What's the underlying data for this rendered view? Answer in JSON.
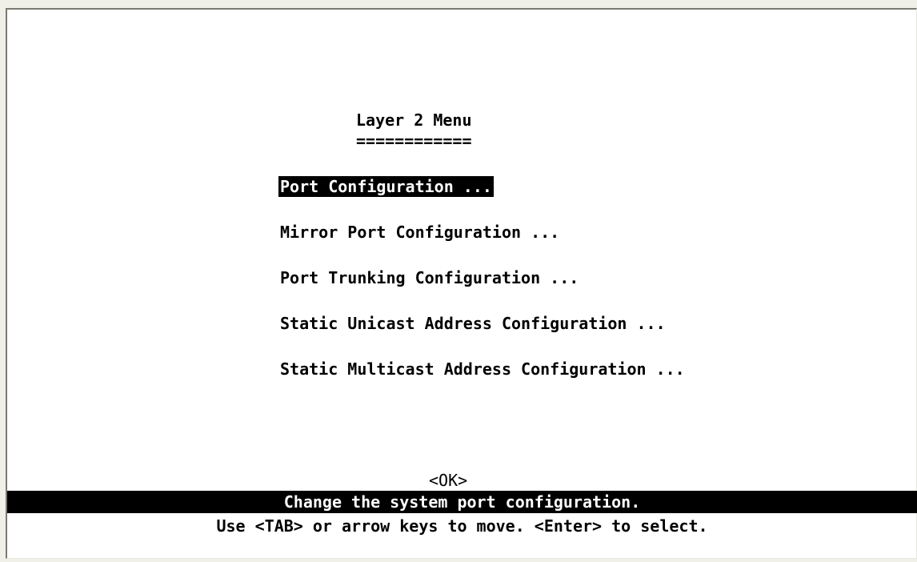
{
  "menu": {
    "title": "Layer 2 Menu",
    "title_underline": "============",
    "items": [
      {
        "label": "Port Configuration ...",
        "selected": true
      },
      {
        "label": "Mirror Port Configuration ...",
        "selected": false
      },
      {
        "label": "Port Trunking Configuration ...",
        "selected": false
      },
      {
        "label": "Static Unicast Address Configuration ...",
        "selected": false
      },
      {
        "label": "Static Multicast Address Configuration ...",
        "selected": false
      }
    ]
  },
  "ok_button": {
    "label": "<OK>"
  },
  "status": {
    "message": "Change the system port configuration.",
    "help": "Use <TAB> or arrow keys to move. <Enter> to select."
  },
  "colors": {
    "background": "#ffffff",
    "text": "#000000",
    "highlight_bg": "#000000",
    "highlight_text": "#ffffff",
    "outer": "#f0efe8"
  }
}
